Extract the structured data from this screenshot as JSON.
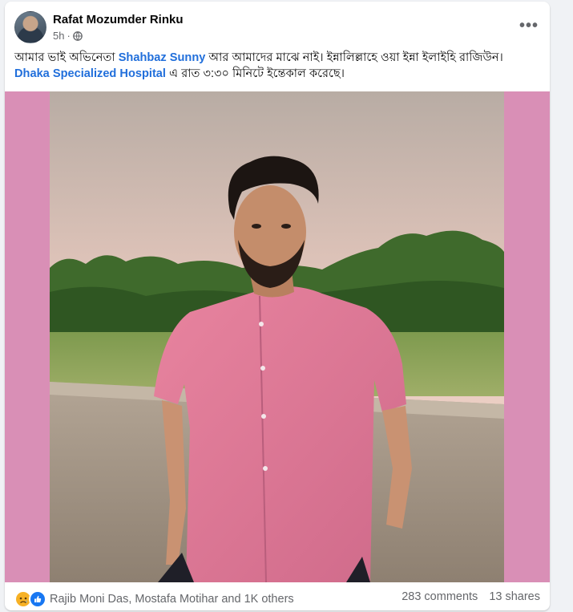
{
  "post": {
    "author": "Rafat Mozumder Rinku",
    "time": "5h",
    "dot": "·",
    "privacy_icon": "globe-icon",
    "more_label": "•••",
    "text": {
      "part1": "আমার ভাই অভিনেতা ",
      "link1": "Shahbaz Sunny",
      "part2": " আর আমাদের মাঝে নাই। ইন্নালিল্লাহে ওয়া ইন্না ইলাইহি রাজিউন। ",
      "link2": "Dhaka Specialized Hospital",
      "part3": " এ রাত ৩:৩০ মিনিটে ইন্তেকাল করেছে।"
    },
    "media": {
      "border_color": "#d98fb6"
    },
    "reactions": {
      "icons": [
        "sad-reaction-icon",
        "like-reaction-icon"
      ],
      "names": "Rajib Moni Das, Mostafa Motihar and 1K others"
    },
    "comments": "283 comments",
    "shares": "13 shares"
  },
  "colors": {
    "link": "#216fdb",
    "secondary_text": "#65676b",
    "like_blue": "#1877f2",
    "sad_yellow": "#f7b125"
  }
}
